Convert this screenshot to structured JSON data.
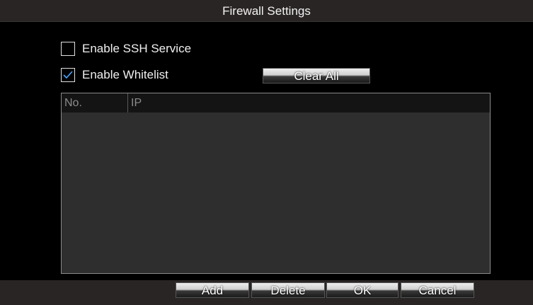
{
  "dialog": {
    "title": "Firewall Settings"
  },
  "options": {
    "ssh": {
      "label": "Enable SSH Service",
      "checked": false
    },
    "whitelist": {
      "label": "Enable Whitelist",
      "checked": true
    }
  },
  "buttons": {
    "clear_all": "Clear All",
    "add": "Add",
    "delete": "Delete",
    "ok": "OK",
    "cancel": "Cancel"
  },
  "table": {
    "columns": [
      "No.",
      "IP"
    ],
    "rows": []
  },
  "colors": {
    "accent": "#4da6ff",
    "background": "#000000",
    "titlebar": "#2a2525"
  }
}
